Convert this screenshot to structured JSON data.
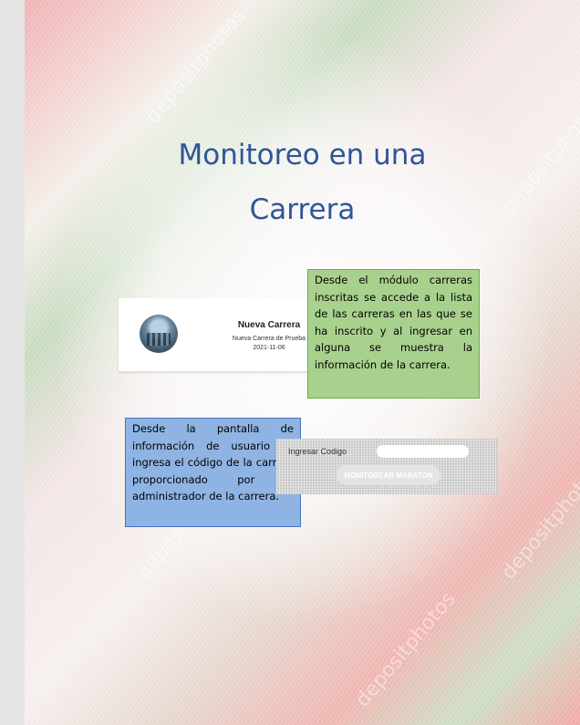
{
  "document": {
    "title_line1": "Monitoreo en una",
    "title_line2": "Carrera"
  },
  "race_card": {
    "title": "Nueva Carrera",
    "subtitle": "Nueva Carrera de Prueba",
    "date": "2021-11-06"
  },
  "notes": {
    "green": "Desde el módulo carreras inscritas se accede a la lista de las carreras en las que se ha inscrito y al ingresar en alguna se muestra la información de la carrera.",
    "blue": "Desde la pantalla de información de usuario se ingresa el código de la carrera proporcionado por el administrador de la carrera."
  },
  "code_form": {
    "label": "Ingresar Codigo",
    "input_value": "",
    "button_label": "MONITOREAR MARATON"
  },
  "watermark": {
    "text": "depositphotos"
  },
  "colors": {
    "title": "#2f5597",
    "green_note": "#a9d18e",
    "blue_note": "#8fb4e3"
  }
}
